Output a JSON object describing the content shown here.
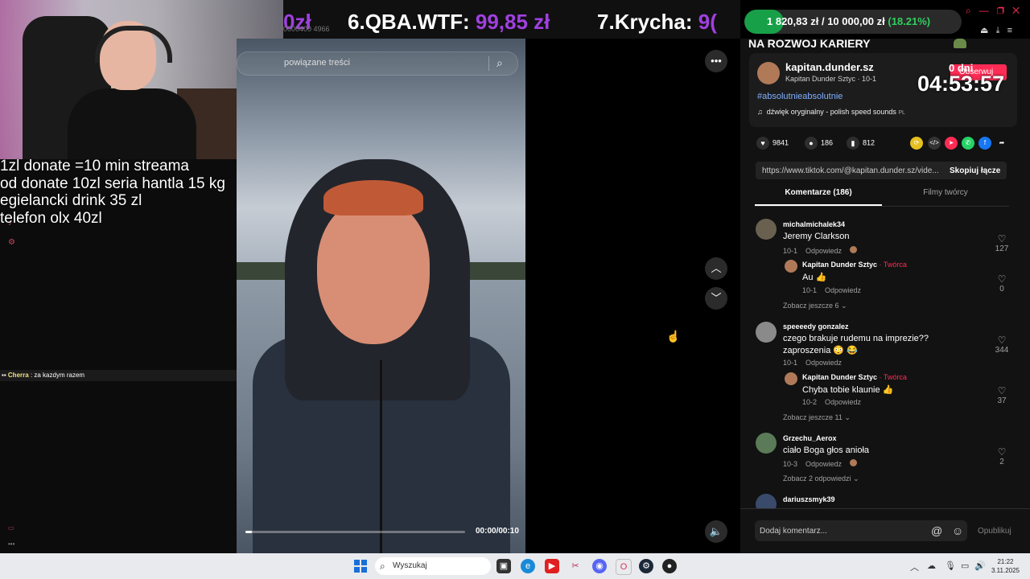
{
  "banner": {
    "prev_amount": "0zł",
    "item6_rank": "6.",
    "item6_name": "QBA.WTF:",
    "item6_amount": "99,85 zł",
    "item7_rank": "7.",
    "item7_name": "Krycha:",
    "item7_amount": "9(",
    "id_text": "0000400 4966"
  },
  "goal": {
    "current": "1 820,83 zł",
    "separator": "/",
    "target": "10 000,00 zł",
    "percent_label": "(18.21%)",
    "progress": 0.1821,
    "fill_color": "#18a048"
  },
  "overlay": {
    "lines": [
      "1zl donate =10 min streama",
      "od donate 10zl seria hantla 15 kg",
      "egielancki drink 35 zl",
      "telefon olx 40zl"
    ]
  },
  "chat": {
    "nick": "Cherra",
    "message": ": za kazdym razem"
  },
  "video": {
    "search_placeholder": "powiązane treści",
    "time": "00:00/00:10",
    "progress": 0.03,
    "more_icon": "more-dots-icon",
    "up_icon": "chevron-up-icon",
    "down_icon": "chevron-down-icon",
    "volume_icon": "volume-icon"
  },
  "panel": {
    "top_title": "NA ROZWOJ KARIERY",
    "username": "kapitan.dunder.sz",
    "subname": "Kapitan Dunder Sztyc · 10-1",
    "hashtag": "#absolutnieabsolutnie",
    "sound": "dźwięk oryginalny - polish speed sounds",
    "sound_flag": "PL",
    "follow_label": "Obserwuj",
    "timer_days": "0 dni",
    "timer": "04:53:57",
    "likes": "9841",
    "comments": "186",
    "saves": "812",
    "url": "https://www.tiktok.com/@kapitan.dunder.sz/vide...",
    "copy_label": "Skopiuj łącze",
    "tab_comments": "Komentarze (186)",
    "tab_creator": "Filmy twórcy",
    "accent": "#fe2c55"
  },
  "comments": [
    {
      "user": "michalmichalek34",
      "text": "Jeremy Clarkson",
      "date": "10-1",
      "reply": "Odpowiedz",
      "likes": "127"
    },
    {
      "user": "Kapitan Dunder Sztyc",
      "creator": " · Twórca",
      "text": "Au 👍",
      "date": "10-1",
      "reply": "Odpowiedz",
      "likes": "0"
    },
    {
      "more": "Zobacz jeszcze 6"
    },
    {
      "user": "speeeedy gonzalez",
      "text": "czego brakuje rudemu na imprezie??",
      "text2": "zaproszenia 😳 😂",
      "date": "10-1",
      "reply": "Odpowiedz",
      "likes": "344"
    },
    {
      "user": "Kapitan Dunder Sztyc",
      "creator": " · Twórca",
      "text": "Chyba tobie klaunie 👍",
      "date": "10-2",
      "reply": "Odpowiedz",
      "likes": "37"
    },
    {
      "more": "Zobacz jeszcze 11"
    },
    {
      "user": "Grzechu_Aerox",
      "text": "ciało Boga głos anioła",
      "date": "10-3",
      "reply": "Odpowiedz",
      "likes": "2"
    },
    {
      "more": "Zobacz 2 odpowiedzi"
    },
    {
      "user": "dariuszsmyk39"
    }
  ],
  "input": {
    "placeholder": "Dodaj komentarz...",
    "publish": "Opublikuj"
  },
  "taskbar": {
    "search_placeholder": "Wyszukaj",
    "time": "21:22",
    "date": "3.11.2025"
  }
}
